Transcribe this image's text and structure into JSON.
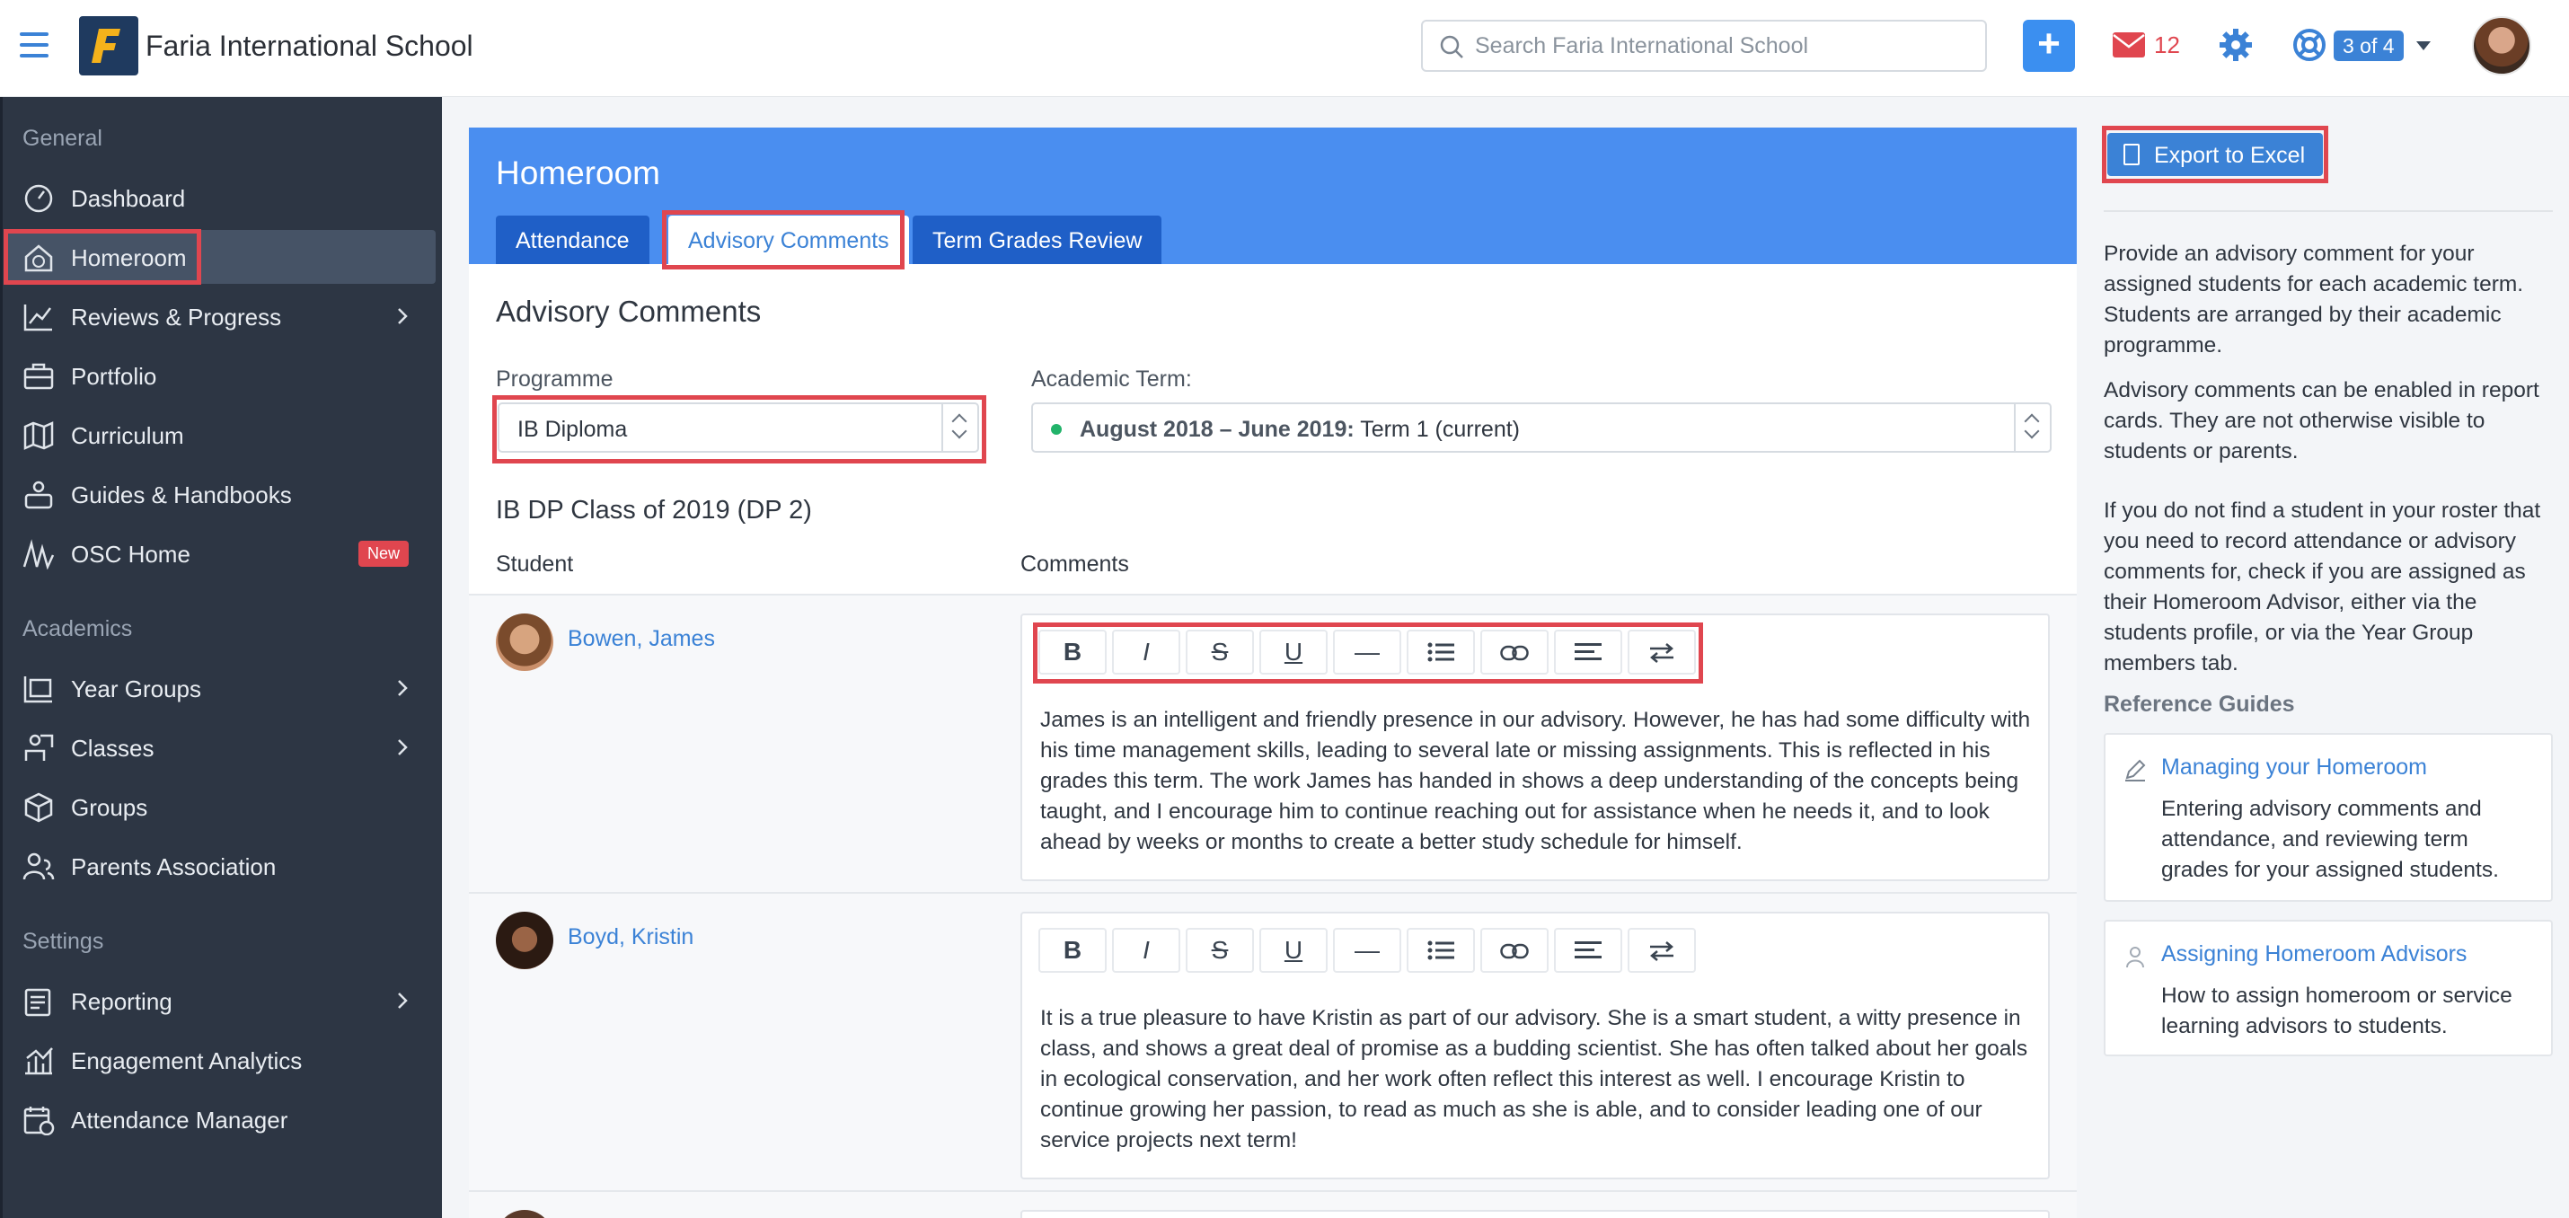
{
  "app": {
    "school_name": "Faria International School"
  },
  "topbar": {
    "search_placeholder": "Search Faria International School",
    "add_label": "+",
    "mail_count": "12",
    "help_badge": "3 of 4"
  },
  "sidebar": {
    "sections": [
      {
        "title": "General",
        "items": [
          {
            "label": "Dashboard",
            "icon": "dashboard-icon"
          },
          {
            "label": "Homeroom",
            "icon": "homeroom-icon",
            "active": true
          },
          {
            "label": "Reviews & Progress",
            "icon": "chart-icon",
            "has_children": true
          },
          {
            "label": "Portfolio",
            "icon": "briefcase-icon"
          },
          {
            "label": "Curriculum",
            "icon": "map-icon"
          },
          {
            "label": "Guides & Handbooks",
            "icon": "users-icon"
          },
          {
            "label": "OSC Home",
            "icon": "osc-icon",
            "badge": "New"
          }
        ]
      },
      {
        "title": "Academics",
        "items": [
          {
            "label": "Year Groups",
            "icon": "layers-icon",
            "has_children": true
          },
          {
            "label": "Classes",
            "icon": "class-icon",
            "has_children": true
          },
          {
            "label": "Groups",
            "icon": "cube-icon"
          },
          {
            "label": "Parents Association",
            "icon": "parents-icon"
          }
        ]
      },
      {
        "title": "Settings",
        "items": [
          {
            "label": "Reporting",
            "icon": "report-icon",
            "has_children": true
          },
          {
            "label": "Engagement Analytics",
            "icon": "analytics-icon"
          },
          {
            "label": "Attendance Manager",
            "icon": "calendar-icon"
          }
        ]
      }
    ]
  },
  "main": {
    "title": "Homeroom",
    "tabs": [
      {
        "label": "Attendance",
        "selected": false
      },
      {
        "label": "Advisory Comments",
        "selected": true
      },
      {
        "label": "Term Grades Review",
        "selected": false
      }
    ],
    "section_title": "Advisory Comments",
    "programme_label": "Programme",
    "programme_value": "IB Diploma",
    "term_label": "Academic Term:",
    "term_range": "August 2018 – June 2019:",
    "term_value": "Term 1 (current)",
    "class_title": "IB DP Class of 2019 (DP 2)",
    "col_student": "Student",
    "col_comments": "Comments",
    "toolbar": [
      "B",
      "I",
      "S",
      "U",
      "—",
      "list",
      "link",
      "align",
      "swap"
    ],
    "students": [
      {
        "name": "Bowen, James",
        "comment": "James is an intelligent and friendly presence in our advisory. However, he has had some difficulty with his time management skills, leading to several late or missing assignments. This is reflected in his grades this term. The work James has handed in shows a deep understanding of the concepts being taught, and I encourage him to continue reaching out for assistance when he needs it, and to look ahead by weeks or months to create a better study schedule for himself."
      },
      {
        "name": "Boyd, Kristin",
        "comment": "It is a true pleasure to have Kristin as part of our advisory. She is a smart student, a witty presence in class, and shows a great deal of promise as a budding scientist. She has often talked about her goals in ecological conservation, and her work often reflect this interest as well. I encourage Kristin to continue growing her passion, to read as much as she is able, and to consider leading one of our service projects next term!"
      }
    ]
  },
  "right": {
    "export_label": "Export to Excel",
    "info": [
      "Provide an advisory comment for your assigned students for each academic term. Students are arranged by their academic programme.",
      "Advisory comments can be enabled in report cards. They are not otherwise visible to students or parents.",
      "If you do not find a student in your roster that you need to record attendance or advisory comments for, check if you are assigned as their Homeroom Advisor, either via the students profile, or via the Year Group members tab."
    ],
    "ref_title": "Reference Guides",
    "guides": [
      {
        "title": "Managing your Homeroom",
        "desc": "Entering advisory comments and attendance, and reviewing term grades for your assigned students.",
        "icon": "pencil-icon"
      },
      {
        "title": "Assigning Homeroom Advisors",
        "desc": "How to assign homeroom or service learning advisors to students.",
        "icon": "person-icon"
      }
    ]
  },
  "colors": {
    "accent": "#3b82d6",
    "header_blue": "#4a8ef0",
    "sidebar_bg": "#2d3644",
    "highlight": "#e0464f"
  }
}
